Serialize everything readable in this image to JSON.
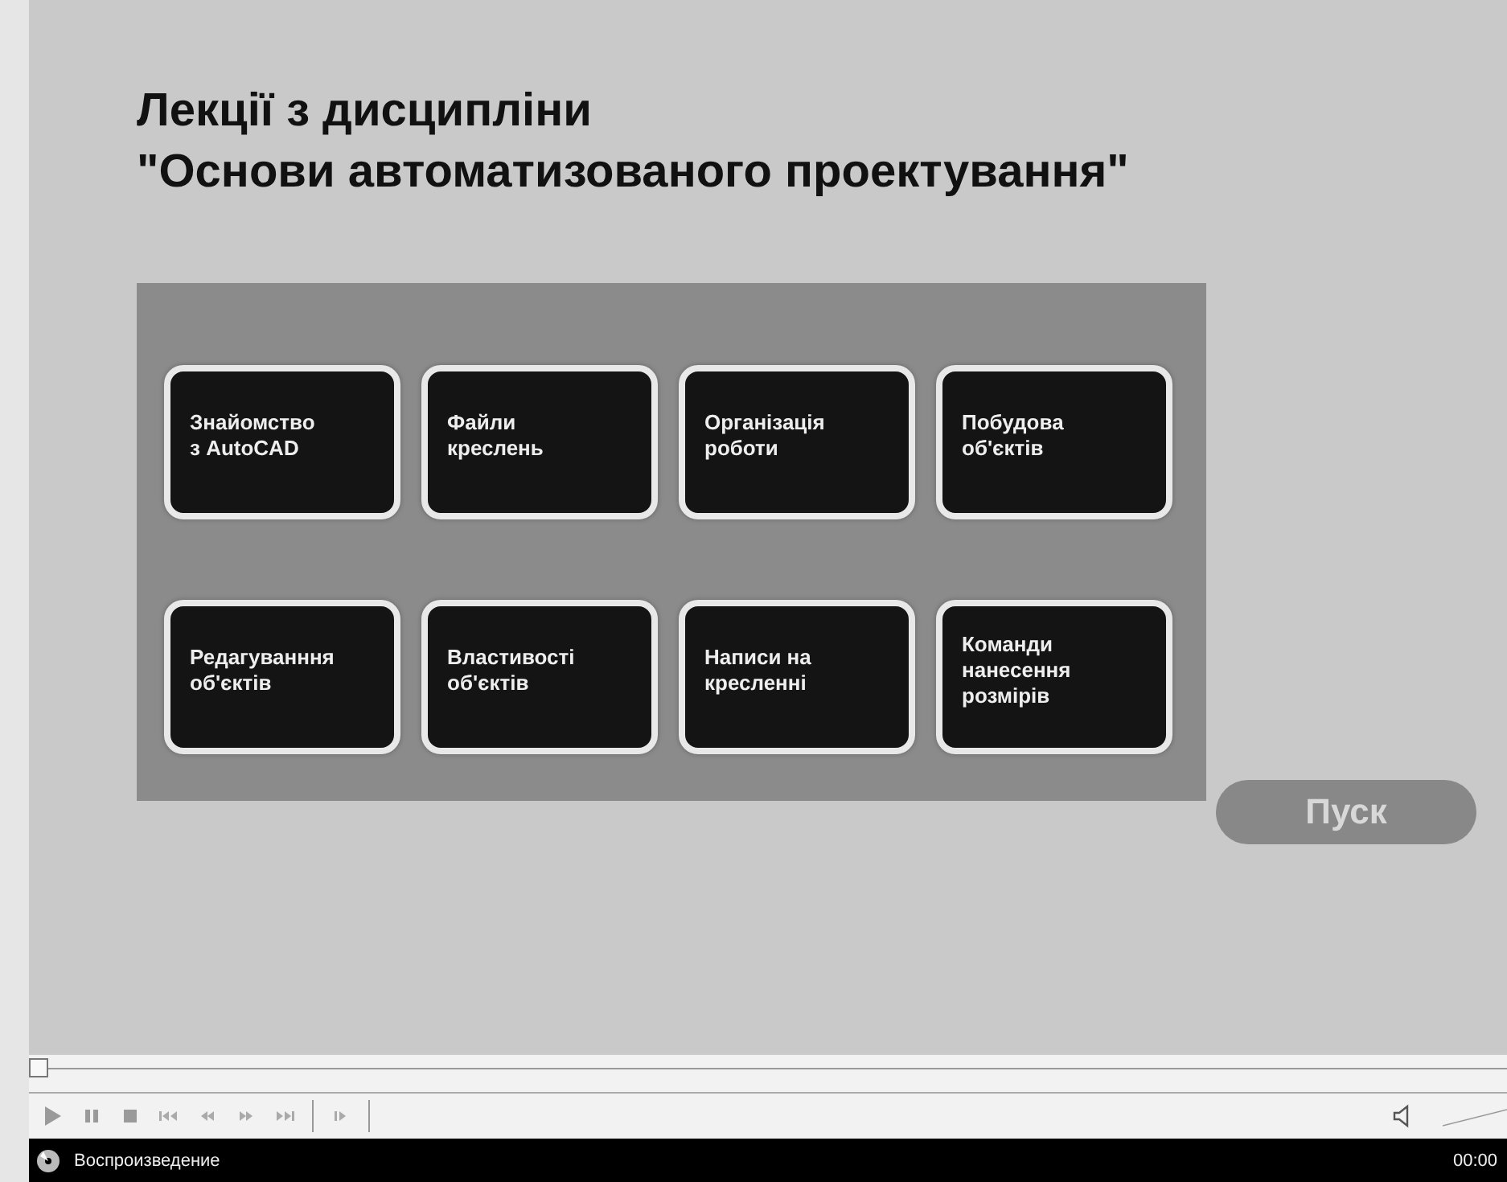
{
  "slide": {
    "title_lines": [
      "Лекції з дисципліни",
      "\"Основи автоматизованого проектування\""
    ],
    "tiles": [
      {
        "label": "Знайомство\nз AutoCAD"
      },
      {
        "label": "Файли\nкреслень"
      },
      {
        "label": "Організація\nроботи"
      },
      {
        "label": "Побудова\nоб'єктів"
      },
      {
        "label": "Редагуванння\nоб'єктів"
      },
      {
        "label": "Властивості\nоб'єктів"
      },
      {
        "label": "Написи на\nкресленні"
      },
      {
        "label": "Команди\nнанесення\nрозмірів"
      }
    ],
    "start_button": "Пуск"
  },
  "player": {
    "status": "Воспроизведение",
    "time": "00:00"
  }
}
